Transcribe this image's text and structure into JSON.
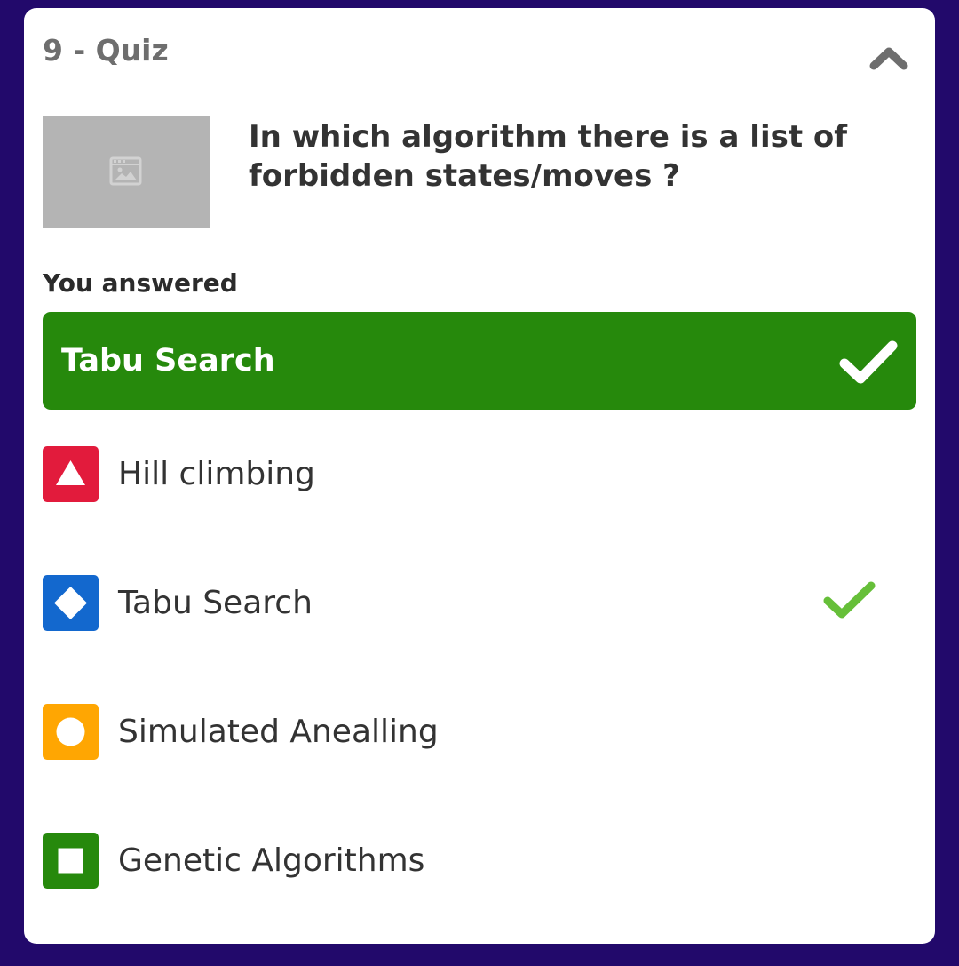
{
  "quiz": {
    "title": "9 - Quiz",
    "question": "In which algorithm there is a list of forbidden states/moves ?",
    "answered_label": "You answered",
    "your_answer": "Tabu Search",
    "your_answer_correct": true
  },
  "options": [
    {
      "label": "Hill climbing",
      "shape": "triangle",
      "color": "#e21b3c",
      "correct": false
    },
    {
      "label": "Tabu Search",
      "shape": "diamond",
      "color": "#1368ce",
      "correct": true
    },
    {
      "label": "Simulated Anealling",
      "shape": "circle",
      "color": "#ffa602",
      "correct": false
    },
    {
      "label": "Genetic Algorithms",
      "shape": "square",
      "color": "#26890c",
      "correct": false
    }
  ],
  "icons": {
    "collapse": "chevron-up-icon",
    "image_placeholder": "image-placeholder-icon",
    "check": "check-icon"
  },
  "colors": {
    "page_background": "#22096b",
    "card_background": "#ffffff",
    "correct_banner": "#26890c",
    "correct_check": "#66bf39"
  }
}
